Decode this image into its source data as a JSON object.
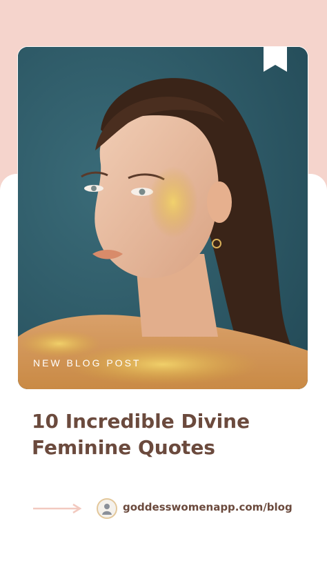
{
  "card": {
    "overlay_label": "NEW BLOG POST",
    "image_subject": "woman with gold glitter on face and shoulders",
    "bookmark_icon": "bookmark-icon"
  },
  "post": {
    "title_line1": "10 Incredible Divine",
    "title_line2": "Feminine Quotes"
  },
  "cta": {
    "arrow_icon": "arrow-right-icon",
    "avatar_icon": "goddess-logo-icon",
    "url": "goddesswomenapp.com/blog"
  },
  "colors": {
    "background_top": "#f5d4cc",
    "text_brown": "#6b4a3d",
    "arrow_pink": "#f2c9bf",
    "photo_bg": "#2e5a68",
    "gold": "#d4a64a"
  }
}
